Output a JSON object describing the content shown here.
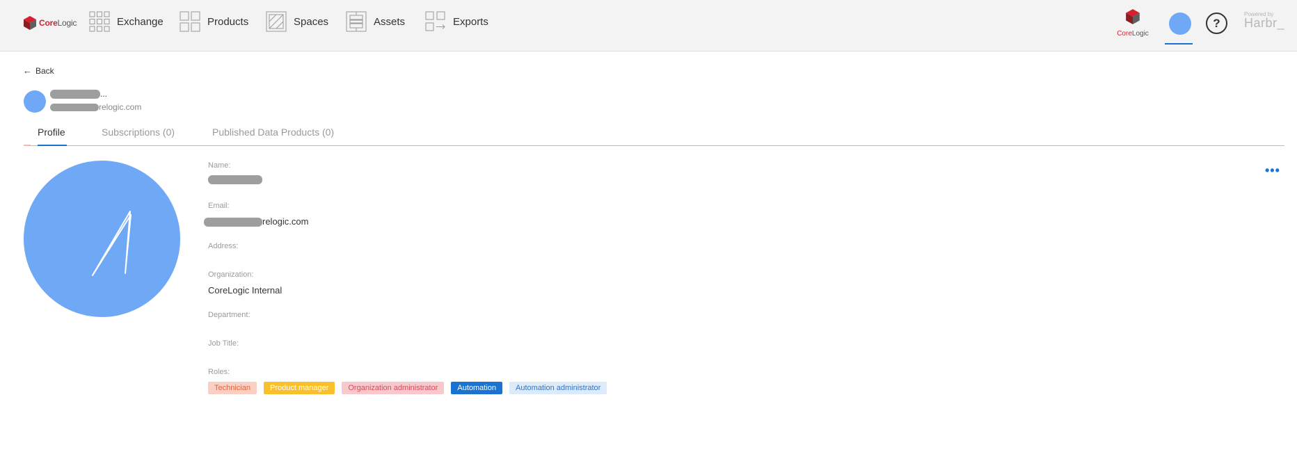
{
  "brand": {
    "core": "Core",
    "logic": "Logic",
    "right_core": "Core",
    "right_logic": "Logic"
  },
  "nav": [
    {
      "label": "Exchange",
      "icon": "grid-icon"
    },
    {
      "label": "Products",
      "icon": "squares-icon"
    },
    {
      "label": "Spaces",
      "icon": "hatched-square-icon"
    },
    {
      "label": "Assets",
      "icon": "stack-icon"
    },
    {
      "label": "Exports",
      "icon": "export-arrow-icon"
    }
  ],
  "help_label": "?",
  "powered": {
    "small": "Powered by",
    "brand": "Harbr_"
  },
  "back_label": "Back",
  "header": {
    "name_suffix": "...",
    "email_suffix": "relogic.com"
  },
  "tabs": [
    {
      "label": "Profile",
      "active": true
    },
    {
      "label": "Subscriptions (0)",
      "active": false
    },
    {
      "label": "Published Data Products (0)",
      "active": false
    }
  ],
  "fields": {
    "name_label": "Name:",
    "email_label": "Email:",
    "email_value_suffix": "relogic.com",
    "address_label": "Address:",
    "organization_label": "Organization:",
    "organization_value": "CoreLogic Internal",
    "department_label": "Department:",
    "job_title_label": "Job Title:",
    "roles_label": "Roles:"
  },
  "more_label": "•••",
  "roles": [
    {
      "label": "Technician",
      "bg": "#fbd0c4",
      "fg": "#e0663e"
    },
    {
      "label": "Product manager",
      "bg": "#f9c02c",
      "fg": "#ffffff"
    },
    {
      "label": "Organization administrator",
      "bg": "#f9c8cd",
      "fg": "#d94a56"
    },
    {
      "label": "Automation",
      "bg": "#1a73d1",
      "fg": "#ffffff"
    },
    {
      "label": "Automation administrator",
      "bg": "#dcebfb",
      "fg": "#2f74c8"
    }
  ],
  "colors": {
    "accent": "#1a73d1",
    "avatar": "#6fa9f5",
    "brand_red": "#d6202f"
  }
}
